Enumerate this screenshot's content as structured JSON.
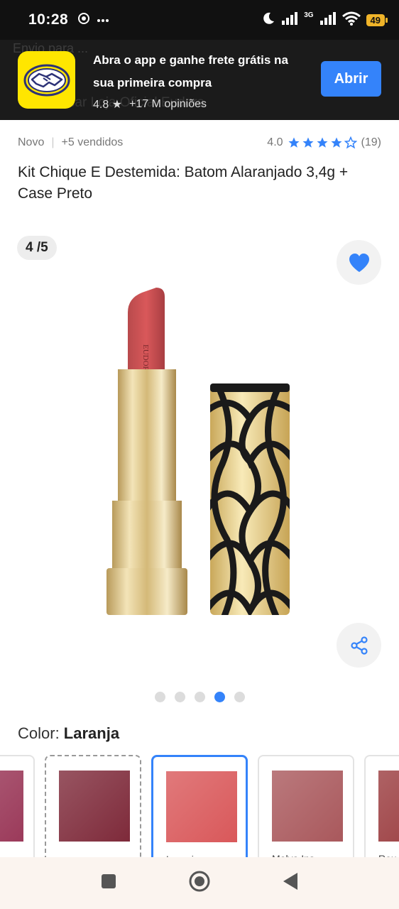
{
  "status_bar": {
    "time": "10:28",
    "network": "3G",
    "battery": "49",
    "icons": [
      "chrome-icon",
      "more-icon",
      "moon-icon",
      "signal-icon",
      "wifi-icon",
      "battery-icon"
    ]
  },
  "app_banner": {
    "title": "Abra o app e ganhe frete grátis na sua primeira compra",
    "rating": "4.8",
    "reviews": "+17 M opiniões",
    "button_label": "Abrir",
    "ghost_text_1": "Envio para ... ",
    "ghost_text_2": "...essar Loja Oficial Eudora"
  },
  "product": {
    "condition": "Novo",
    "sold": "+5 vendidos",
    "rating": "4.0",
    "review_count": "(19)",
    "title": "Kit Chique E Destemida: Batom Alaranjado 3,4g + Case Preto",
    "image_counter": "4 /5",
    "brand_on_lipstick": "EUDORA"
  },
  "gallery": {
    "total": 5,
    "active_index": 3
  },
  "color_selector": {
    "label": "Color: ",
    "selected": "Laranja",
    "swatches": [
      {
        "name": "",
        "color": "#9b3a5a"
      },
      {
        "name": "",
        "color": "#7e2a3a"
      },
      {
        "name": "Laranja",
        "color": "#d9585a"
      },
      {
        "name": "Malva Ins...",
        "color": "#a9585c"
      },
      {
        "name": "Rou...",
        "color": "#9a3b3e"
      }
    ]
  },
  "colors": {
    "accent": "#3483fa",
    "banner_bg": "#1b1b1b",
    "logo_yellow": "#ffe600"
  }
}
